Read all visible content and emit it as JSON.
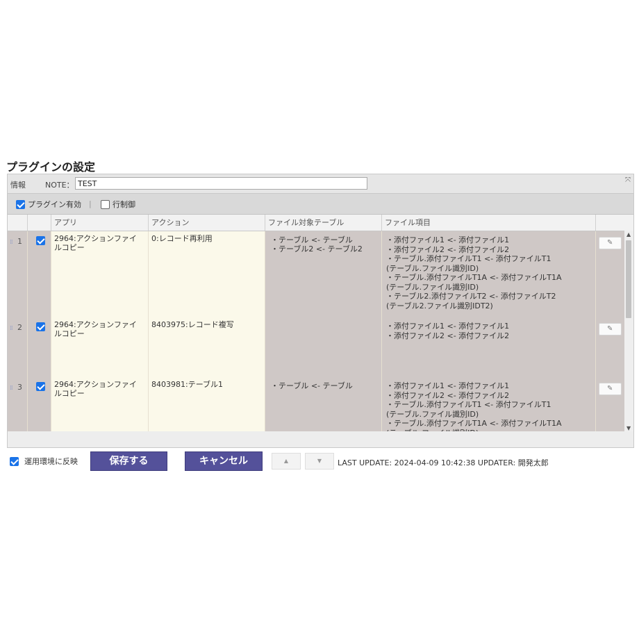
{
  "page_title": "プラグインの設定",
  "info": {
    "label": "情報",
    "note_label": "NOTE：",
    "note_value": "TEST",
    "expand_icon": "expand-icon"
  },
  "options": {
    "plugin_enabled": "プラグイン有効",
    "row_control": "行制御",
    "separator": "|"
  },
  "columns": [
    "アプリ",
    "アクション",
    "ファイル対象テーブル",
    "ファイル項目"
  ],
  "rows": [
    {
      "num": "1",
      "checked": true,
      "app": [
        "2964:アクションファイ",
        "ルコピー"
      ],
      "action": [
        "0:レコード再利用"
      ],
      "tables": [
        "・テーブル <- テーブル",
        "・テーブル2 <- テーブル2"
      ],
      "files": [
        "・添付ファイル1 <- 添付ファイル1",
        "・添付ファイル2 <- 添付ファイル2",
        "・テーブル.添付ファイルT1 <- 添付ファイルT1",
        "(テーブル.ファイル識別ID)",
        "・テーブル.添付ファイルT1A <- 添付ファイルT1A",
        "(テーブル.ファイル識別ID)",
        "・テーブル2.添付ファイルT2 <- 添付ファイルT2",
        "(テーブル2.ファイル識別IDT2)"
      ]
    },
    {
      "num": "2",
      "checked": true,
      "app": [
        "2964:アクションファイ",
        "ルコピー"
      ],
      "action": [
        "8403975:レコード複写"
      ],
      "tables": [],
      "files": [
        "・添付ファイル1 <- 添付ファイル1",
        "・添付ファイル2 <- 添付ファイル2"
      ]
    },
    {
      "num": "3",
      "checked": true,
      "app": [
        "2964:アクションファイ",
        "ルコピー"
      ],
      "action": [
        "8403981:テーブル1"
      ],
      "tables": [
        "・テーブル <- テーブル"
      ],
      "files": [
        "・添付ファイル1 <- 添付ファイル1",
        "・添付ファイル2 <- 添付ファイル2",
        "・テーブル.添付ファイルT1 <- 添付ファイルT1",
        "(テーブル.ファイル識別ID)",
        "・テーブル.添付ファイルT1A <- 添付ファイルT1A",
        "(テーブル.ファイル識別ID)"
      ]
    }
  ],
  "footer": {
    "apply_label": "運用環境に反映",
    "save_label": "保存する",
    "cancel_label": "キャンセル",
    "up_label": "▲",
    "down_label": "▼",
    "last_update": "LAST UPDATE: 2024-04-09 10:42:38 UPDATER: 開発太郎"
  },
  "colors": {
    "primary_button": "#54519a",
    "checkbox": "#1a73e8",
    "highlight_cell": "#fbf9ea",
    "row_bg": "#cfc8c6"
  }
}
